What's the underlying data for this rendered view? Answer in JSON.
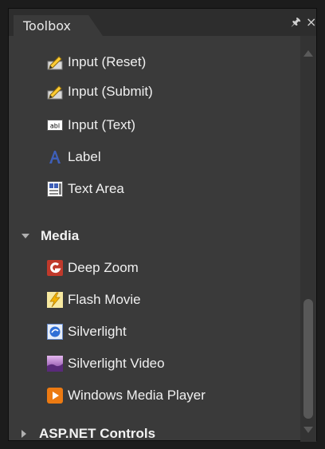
{
  "panel": {
    "title": "Toolbox",
    "pin_icon": "pin-icon",
    "close_icon": "close-icon",
    "pin_glyph": "🖈",
    "close_glyph": "×"
  },
  "items_top": [
    {
      "label": "Input (Reset)",
      "icon": "input-reset-icon"
    },
    {
      "label": "Input (Submit)",
      "icon": "input-submit-icon"
    },
    {
      "label": "Input (Text)",
      "icon": "input-text-icon"
    },
    {
      "label": "Label",
      "icon": "label-icon"
    },
    {
      "label": "Text Area",
      "icon": "text-area-icon"
    }
  ],
  "groups": [
    {
      "label": "Media",
      "expanded": true
    },
    {
      "label": "ASP.NET Controls",
      "expanded": false
    }
  ],
  "media_items": [
    {
      "label": "Deep Zoom",
      "icon": "deep-zoom-icon"
    },
    {
      "label": "Flash Movie",
      "icon": "flash-movie-icon"
    },
    {
      "label": "Silverlight",
      "icon": "silverlight-icon"
    },
    {
      "label": "Silverlight Video",
      "icon": "silverlight-video-icon"
    },
    {
      "label": "Windows Media Player",
      "icon": "windows-media-player-icon"
    }
  ],
  "colors": {
    "panel_bg": "#3a3a3a",
    "header_bg": "#2d2d2d",
    "text": "#f0f0f0",
    "scroll_thumb": "#585858"
  }
}
